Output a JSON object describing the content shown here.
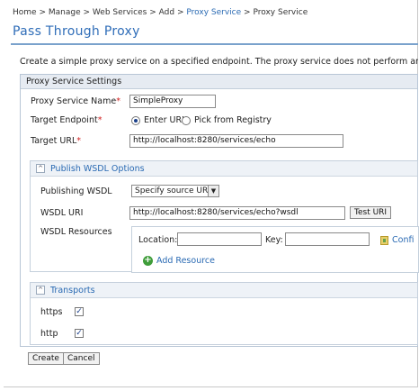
{
  "breadcrumb": {
    "items": [
      "Home",
      "Manage",
      "Web Services",
      "Add",
      "Proxy Service",
      "Proxy Service"
    ],
    "separator": ">"
  },
  "page": {
    "title": "Pass Through Proxy",
    "description": "Create a simple proxy service on a specified endpoint. The proxy service does not perform any processing"
  },
  "settings": {
    "header": "Proxy Service Settings",
    "proxy_service_name_label": "Proxy Service Name",
    "proxy_service_name_value": "SimpleProxy",
    "target_endpoint_label": "Target Endpoint",
    "target_endpoint_options": [
      "Enter URL",
      "Pick from Registry"
    ],
    "target_endpoint_selected": "Enter URL",
    "target_url_label": "Target URL",
    "target_url_value": "http://localhost:8280/services/echo",
    "required_marker": "*"
  },
  "wsdl": {
    "section_title": "Publish WSDL Options",
    "collapse_glyph": "^",
    "publishing_label": "Publishing WSDL",
    "publishing_value": "Specify source URL",
    "uri_label": "WSDL URI",
    "uri_value": "http://localhost:8280/services/echo?wsdl",
    "test_button": "Test URI",
    "resources_label": "WSDL Resources",
    "location_label": "Location:",
    "key_label": "Key:",
    "configure_label": "Confi",
    "add_resource_label": "Add Resource"
  },
  "transports": {
    "section_title": "Transports",
    "collapse_glyph": "^",
    "items": [
      {
        "label": "https",
        "checked": true
      },
      {
        "label": "http",
        "checked": true
      }
    ]
  },
  "actions": {
    "create": "Create",
    "cancel": "Cancel"
  },
  "colors": {
    "accent": "#2f6db8",
    "link": "#2a6ab3",
    "required": "#d12020",
    "panel_header": "#e6ebf2"
  },
  "icons": [
    "chevron-up-icon",
    "add-icon",
    "configure-icon",
    "checkbox-checked-icon",
    "dropdown-arrow-icon"
  ]
}
